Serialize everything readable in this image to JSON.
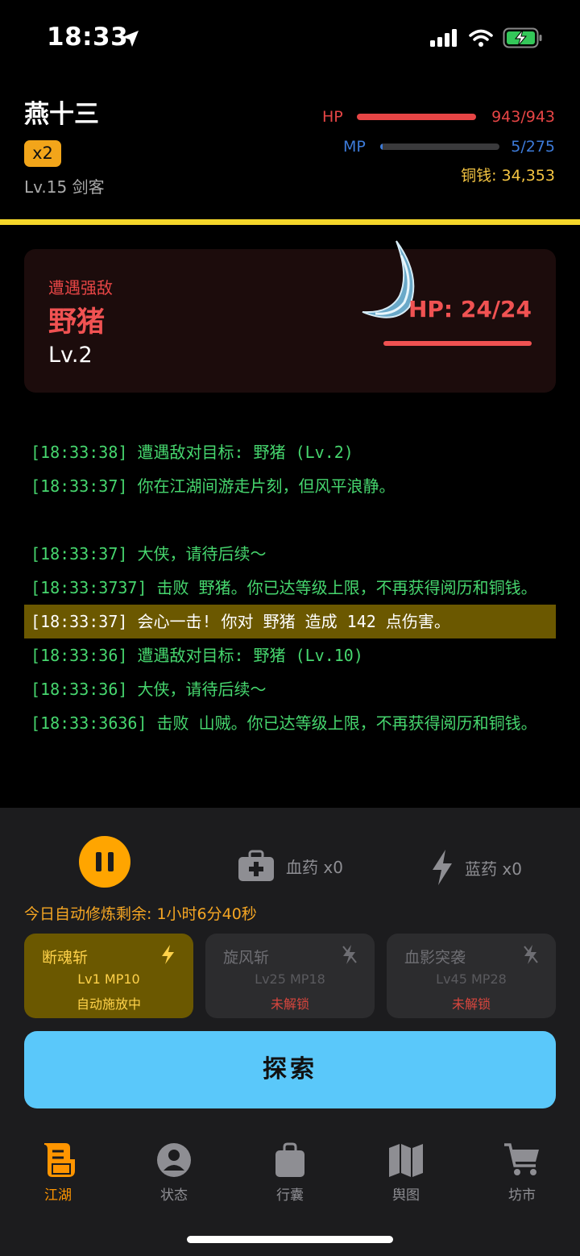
{
  "status_bar": {
    "time": "18:33"
  },
  "player": {
    "name": "燕十三",
    "multiplier": "x2",
    "level": "Lv.15 剑客",
    "hp_label": "HP",
    "hp_value": "943/943",
    "hp_fraction": 1.0,
    "mp_label": "MP",
    "mp_value": "5/275",
    "mp_fraction": 0.018,
    "money": "铜钱: 34,353"
  },
  "enemy": {
    "tag": "遭遇强敌",
    "name": "野猪",
    "level": "Lv.2",
    "hp": "HP: 24/24"
  },
  "log": [
    {
      "text": "[18:33:38] 遭遇敌对目标: 野猪 (Lv.2)",
      "crit": false
    },
    {
      "text": "[18:33:37] 你在江湖间游走片刻，但风平浪静。",
      "crit": false
    },
    {
      "gap": true
    },
    {
      "text": "[18:33:37] 大侠，请待后续～",
      "crit": false
    },
    {
      "text": "[18:33:3737] 击败 野猪。你已达等级上限，不再获得阅历和铜钱。",
      "crit": false
    },
    {
      "text": "[18:33:37] 会心一击! 你对 野猪 造成 142 点伤害。",
      "crit": true
    },
    {
      "text": "[18:33:36] 遭遇敌对目标: 野猪 (Lv.10)",
      "crit": false
    },
    {
      "text": "[18:33:36] 大侠，请待后续～",
      "crit": false
    },
    {
      "text": "[18:33:3636] 击败 山贼。你已达等级上限，不再获得阅历和铜钱。",
      "crit": false
    }
  ],
  "controls": {
    "hp_potion": "血药 x0",
    "mp_potion": "蓝药 x0",
    "auto_remaining": "今日自动修炼剩余: 1小时6分40秒"
  },
  "skills": [
    {
      "name": "断魂斩",
      "level": "Lv1 MP10",
      "state": "自动施放中",
      "active": true
    },
    {
      "name": "旋风斩",
      "level": "Lv25 MP18",
      "state": "未解锁",
      "active": false
    },
    {
      "name": "血影突袭",
      "level": "Lv45 MP28",
      "state": "未解锁",
      "active": false
    }
  ],
  "explore_label": "探索",
  "tabs": [
    {
      "label": "江湖",
      "icon": "scroll-icon",
      "active": true
    },
    {
      "label": "状态",
      "icon": "person-icon",
      "active": false
    },
    {
      "label": "行囊",
      "icon": "bag-icon",
      "active": false
    },
    {
      "label": "舆图",
      "icon": "map-icon",
      "active": false
    },
    {
      "label": "坊市",
      "icon": "cart-icon",
      "active": false
    }
  ],
  "colors": {
    "accent": "#ff9500",
    "hp": "#e64545",
    "mp": "#3d7bd9",
    "divider": "#f5d72a",
    "explore": "#5ac8fa"
  }
}
